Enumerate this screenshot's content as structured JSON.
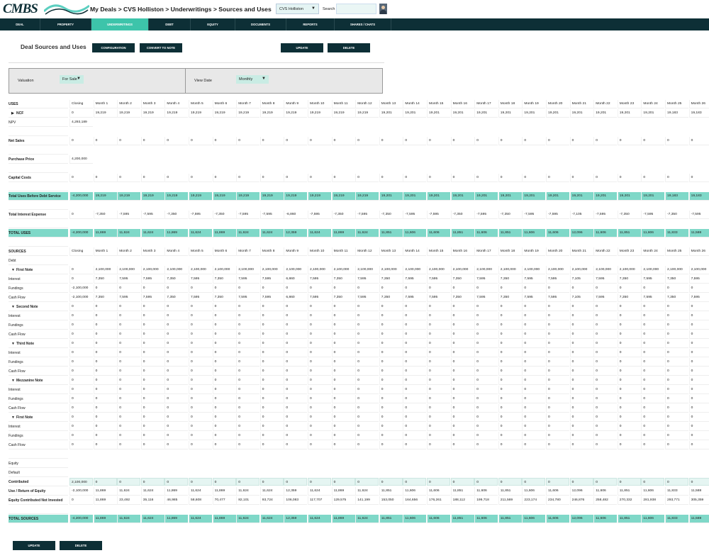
{
  "header": {
    "logo": "CMBS",
    "breadcrumb": "My Deals > CVS Holliston > Underwritings > Sources and Uses",
    "deal_select": "CVS Holliston",
    "search_label": "Search"
  },
  "nav": {
    "tabs": [
      "DEAL",
      "PROPERTY",
      "UNDERWRITINGS",
      "DEBT",
      "EQUITY",
      "DOCUMENTS",
      "REPORTS",
      "SHARES / CHATS"
    ],
    "active": "UNDERWRITINGS"
  },
  "page": {
    "title": "Deal Sources and Uses",
    "configuration": "CONFIGURATION",
    "convert": "CONVERT TO NOTE",
    "update": "UPDATE",
    "delete": "DELETE"
  },
  "filters": {
    "valuation_label": "Valuation",
    "valuation": "For Sale",
    "viewdate_label": "View Date",
    "viewdate": "Monthly"
  },
  "columns": [
    "Closing",
    "Month 1",
    "Month 2",
    "Month 3",
    "Month 4",
    "Month 5",
    "Month 6",
    "Month 7",
    "Month 8",
    "Month 9",
    "Month 10",
    "Month 11",
    "Month 12",
    "Month 13",
    "Month 14",
    "Month 15",
    "Month 16",
    "Month 17",
    "Month 18",
    "Month 19",
    "Month 20",
    "Month 21",
    "Month 22",
    "Month 23",
    "Month 24",
    "Month 25",
    "Month 26"
  ],
  "rows": [
    {
      "label": "USES",
      "bold": true,
      "header": true
    },
    {
      "label": "NCF",
      "bold": true,
      "chev": "▶",
      "values": [
        "0",
        "19,219",
        "19,219",
        "19,219",
        "19,219",
        "19,219",
        "19,219",
        "19,219",
        "19,219",
        "19,219",
        "19,219",
        "19,219",
        "19,219",
        "19,201",
        "19,201",
        "19,201",
        "19,201",
        "19,201",
        "19,201",
        "19,201",
        "19,201",
        "19,201",
        "19,201",
        "19,201",
        "19,201",
        "19,183",
        "19,183"
      ]
    },
    {
      "label": "NPV",
      "values": [
        "4,293,189"
      ]
    },
    {
      "label": ""
    },
    {
      "label": "Net Sales",
      "bold": true,
      "values": [
        "0",
        "0",
        "0",
        "0",
        "0",
        "0",
        "0",
        "0",
        "0",
        "0",
        "0",
        "0",
        "0",
        "0",
        "0",
        "0",
        "0",
        "0",
        "0",
        "0",
        "0",
        "0",
        "0",
        "0",
        "0",
        "0",
        "0"
      ]
    },
    {
      "label": ""
    },
    {
      "label": "Purchase Price",
      "bold": true,
      "values": [
        "4,200,000"
      ]
    },
    {
      "label": ""
    },
    {
      "label": "Capital Costs",
      "bold": true,
      "values": [
        "0",
        "0",
        "0",
        "0",
        "0",
        "0",
        "0",
        "0",
        "0",
        "0",
        "0",
        "0",
        "0",
        "0",
        "0",
        "0",
        "0",
        "0",
        "0",
        "0",
        "0",
        "0",
        "0",
        "0",
        "0",
        "0",
        "0"
      ]
    },
    {
      "label": ""
    },
    {
      "label": "Total Uses Before Debt Service",
      "bold": true,
      "green": true,
      "values": [
        "-4,200,000",
        "19,219",
        "19,219",
        "19,219",
        "19,219",
        "19,219",
        "19,219",
        "19,219",
        "19,219",
        "19,219",
        "19,219",
        "19,219",
        "19,219",
        "19,201",
        "19,201",
        "19,201",
        "19,201",
        "19,201",
        "19,201",
        "19,201",
        "19,201",
        "19,201",
        "19,201",
        "19,201",
        "19,201",
        "19,183",
        "19,183"
      ]
    },
    {
      "label": ""
    },
    {
      "label": "Total Interest Expense",
      "bold": true,
      "values": [
        "0",
        "-7,350",
        "-7,595",
        "-7,595",
        "-7,350",
        "-7,595",
        "-7,350",
        "-7,595",
        "-7,595",
        "-6,860",
        "-7,595",
        "-7,350",
        "-7,595",
        "-7,350",
        "-7,595",
        "-7,595",
        "-7,350",
        "-7,595",
        "-7,350",
        "-7,595",
        "-7,595",
        "-7,105",
        "-7,595",
        "-7,350",
        "-7,595",
        "-7,350",
        "-7,595"
      ]
    },
    {
      "label": ""
    },
    {
      "label": "TOTAL USES",
      "bold": true,
      "green": true,
      "values": [
        "-4,200,000",
        "11,869",
        "11,624",
        "11,624",
        "11,869",
        "11,624",
        "11,869",
        "11,624",
        "11,624",
        "12,359",
        "11,624",
        "11,869",
        "11,624",
        "11,851",
        "11,606",
        "11,606",
        "11,851",
        "11,606",
        "11,851",
        "11,606",
        "11,606",
        "12,096",
        "11,606",
        "11,851",
        "11,606",
        "11,833",
        "11,588"
      ]
    },
    {
      "label": ""
    },
    {
      "label": "SOURCES",
      "bold": true,
      "header": true,
      "colhead": true
    },
    {
      "label": "Debt"
    },
    {
      "label": "First Note",
      "bold": true,
      "chev": "▼",
      "values": [
        "0",
        "2,100,000",
        "2,100,000",
        "2,100,000",
        "2,100,000",
        "2,100,000",
        "2,100,000",
        "2,100,000",
        "2,100,000",
        "2,100,000",
        "2,100,000",
        "2,100,000",
        "2,100,000",
        "2,100,000",
        "2,100,000",
        "2,100,000",
        "2,100,000",
        "2,100,000",
        "2,100,000",
        "2,100,000",
        "2,100,000",
        "2,100,000",
        "2,100,000",
        "2,100,000",
        "2,100,000",
        "2,100,000",
        "2,100,000"
      ]
    },
    {
      "label": "Interest",
      "values": [
        "0",
        "7,350",
        "7,595",
        "7,595",
        "7,350",
        "7,595",
        "7,350",
        "7,595",
        "7,595",
        "6,860",
        "7,595",
        "7,350",
        "7,595",
        "7,350",
        "7,595",
        "7,595",
        "7,350",
        "7,595",
        "7,350",
        "7,595",
        "7,595",
        "7,105",
        "7,595",
        "7,350",
        "7,595",
        "7,350",
        "7,595"
      ]
    },
    {
      "label": "Fundings",
      "values": [
        "-2,100,000",
        "0",
        "0",
        "0",
        "0",
        "0",
        "0",
        "0",
        "0",
        "0",
        "0",
        "0",
        "0",
        "0",
        "0",
        "0",
        "0",
        "0",
        "0",
        "0",
        "0",
        "0",
        "0",
        "0",
        "0",
        "0",
        "0"
      ]
    },
    {
      "label": "Cash Flow",
      "values": [
        "-2,100,000",
        "7,350",
        "7,595",
        "7,595",
        "7,350",
        "7,595",
        "7,350",
        "7,595",
        "7,595",
        "6,860",
        "7,595",
        "7,350",
        "7,595",
        "7,350",
        "7,595",
        "7,595",
        "7,350",
        "7,595",
        "7,350",
        "7,595",
        "7,595",
        "7,105",
        "7,595",
        "7,350",
        "7,595",
        "7,350",
        "7,595"
      ]
    },
    {
      "label": "Second Note",
      "bold": true,
      "chev": "▼",
      "values": [
        "0",
        "0",
        "0",
        "0",
        "0",
        "0",
        "0",
        "0",
        "0",
        "0",
        "0",
        "0",
        "0",
        "0",
        "0",
        "0",
        "0",
        "0",
        "0",
        "0",
        "0",
        "0",
        "0",
        "0",
        "0",
        "0",
        "0"
      ]
    },
    {
      "label": "Interest",
      "values": [
        "0",
        "0",
        "0",
        "0",
        "0",
        "0",
        "0",
        "0",
        "0",
        "0",
        "0",
        "0",
        "0",
        "0",
        "0",
        "0",
        "0",
        "0",
        "0",
        "0",
        "0",
        "0",
        "0",
        "0",
        "0",
        "0",
        "0"
      ]
    },
    {
      "label": "Fundings",
      "values": [
        "0",
        "0",
        "0",
        "0",
        "0",
        "0",
        "0",
        "0",
        "0",
        "0",
        "0",
        "0",
        "0",
        "0",
        "0",
        "0",
        "0",
        "0",
        "0",
        "0",
        "0",
        "0",
        "0",
        "0",
        "0",
        "0",
        "0"
      ]
    },
    {
      "label": "Cash Flow",
      "values": [
        "0",
        "0",
        "0",
        "0",
        "0",
        "0",
        "0",
        "0",
        "0",
        "0",
        "0",
        "0",
        "0",
        "0",
        "0",
        "0",
        "0",
        "0",
        "0",
        "0",
        "0",
        "0",
        "0",
        "0",
        "0",
        "0",
        "0"
      ]
    },
    {
      "label": "Third Note",
      "bold": true,
      "chev": "▼",
      "values": [
        "0",
        "0",
        "0",
        "0",
        "0",
        "0",
        "0",
        "0",
        "0",
        "0",
        "0",
        "0",
        "0",
        "0",
        "0",
        "0",
        "0",
        "0",
        "0",
        "0",
        "0",
        "0",
        "0",
        "0",
        "0",
        "0",
        "0"
      ]
    },
    {
      "label": "Interest",
      "values": [
        "0",
        "0",
        "0",
        "0",
        "0",
        "0",
        "0",
        "0",
        "0",
        "0",
        "0",
        "0",
        "0",
        "0",
        "0",
        "0",
        "0",
        "0",
        "0",
        "0",
        "0",
        "0",
        "0",
        "0",
        "0",
        "0",
        "0"
      ]
    },
    {
      "label": "Fundings",
      "values": [
        "0",
        "0",
        "0",
        "0",
        "0",
        "0",
        "0",
        "0",
        "0",
        "0",
        "0",
        "0",
        "0",
        "0",
        "0",
        "0",
        "0",
        "0",
        "0",
        "0",
        "0",
        "0",
        "0",
        "0",
        "0",
        "0",
        "0"
      ]
    },
    {
      "label": "Cash Flow",
      "values": [
        "0",
        "0",
        "0",
        "0",
        "0",
        "0",
        "0",
        "0",
        "0",
        "0",
        "0",
        "0",
        "0",
        "0",
        "0",
        "0",
        "0",
        "0",
        "0",
        "0",
        "0",
        "0",
        "0",
        "0",
        "0",
        "0",
        "0"
      ]
    },
    {
      "label": "Mezzanine Note",
      "bold": true,
      "chev": "▼",
      "values": [
        "0",
        "0",
        "0",
        "0",
        "0",
        "0",
        "0",
        "0",
        "0",
        "0",
        "0",
        "0",
        "0",
        "0",
        "0",
        "0",
        "0",
        "0",
        "0",
        "0",
        "0",
        "0",
        "0",
        "0",
        "0",
        "0",
        "0"
      ]
    },
    {
      "label": "Interest",
      "values": [
        "0",
        "0",
        "0",
        "0",
        "0",
        "0",
        "0",
        "0",
        "0",
        "0",
        "0",
        "0",
        "0",
        "0",
        "0",
        "0",
        "0",
        "0",
        "0",
        "0",
        "0",
        "0",
        "0",
        "0",
        "0",
        "0",
        "0"
      ]
    },
    {
      "label": "Fundings",
      "values": [
        "0",
        "0",
        "0",
        "0",
        "0",
        "0",
        "0",
        "0",
        "0",
        "0",
        "0",
        "0",
        "0",
        "0",
        "0",
        "0",
        "0",
        "0",
        "0",
        "0",
        "0",
        "0",
        "0",
        "0",
        "0",
        "0",
        "0"
      ]
    },
    {
      "label": "Cash Flow",
      "values": [
        "0",
        "0",
        "0",
        "0",
        "0",
        "0",
        "0",
        "0",
        "0",
        "0",
        "0",
        "0",
        "0",
        "0",
        "0",
        "0",
        "0",
        "0",
        "0",
        "0",
        "0",
        "0",
        "0",
        "0",
        "0",
        "0",
        "0"
      ]
    },
    {
      "label": "First Note",
      "bold": true,
      "chev": "▼",
      "values": [
        "0",
        "0",
        "0",
        "0",
        "0",
        "0",
        "0",
        "0",
        "0",
        "0",
        "0",
        "0",
        "0",
        "0",
        "0",
        "0",
        "0",
        "0",
        "0",
        "0",
        "0",
        "0",
        "0",
        "0",
        "0",
        "0",
        "0"
      ]
    },
    {
      "label": "Interest",
      "values": [
        "0",
        "0",
        "0",
        "0",
        "0",
        "0",
        "0",
        "0",
        "0",
        "0",
        "0",
        "0",
        "0",
        "0",
        "0",
        "0",
        "0",
        "0",
        "0",
        "0",
        "0",
        "0",
        "0",
        "0",
        "0",
        "0",
        "0"
      ]
    },
    {
      "label": "Fundings",
      "values": [
        "0",
        "0",
        "0",
        "0",
        "0",
        "0",
        "0",
        "0",
        "0",
        "0",
        "0",
        "0",
        "0",
        "0",
        "0",
        "0",
        "0",
        "0",
        "0",
        "0",
        "0",
        "0",
        "0",
        "0",
        "0",
        "0",
        "0"
      ]
    },
    {
      "label": "Cash Flow",
      "values": [
        "0",
        "0",
        "0",
        "0",
        "0",
        "0",
        "0",
        "0",
        "0",
        "0",
        "0",
        "0",
        "0",
        "0",
        "0",
        "0",
        "0",
        "0",
        "0",
        "0",
        "0",
        "0",
        "0",
        "0",
        "0",
        "0",
        "0"
      ]
    },
    {
      "label": ""
    },
    {
      "label": "Equity"
    },
    {
      "label": "Default"
    },
    {
      "label": "Contributed",
      "bold": true,
      "inputs": true,
      "values": [
        "2,100,000",
        "0",
        "0",
        "0",
        "0",
        "0",
        "0",
        "0",
        "0",
        "0",
        "0",
        "0",
        "0",
        "0",
        "0",
        "0",
        "0",
        "0",
        "0",
        "0",
        "0",
        "0",
        "0",
        "0",
        "0",
        "0",
        "0"
      ]
    },
    {
      "label": "Use / Return of Equity",
      "bold": true,
      "values": [
        "-2,100,000",
        "11,869",
        "11,624",
        "11,624",
        "11,869",
        "11,624",
        "11,869",
        "11,624",
        "11,624",
        "12,359",
        "11,624",
        "11,869",
        "11,624",
        "11,851",
        "11,606",
        "11,606",
        "11,851",
        "11,606",
        "11,851",
        "11,606",
        "11,606",
        "12,096",
        "11,606",
        "11,851",
        "11,606",
        "11,833",
        "11,588"
      ]
    },
    {
      "label": "Equity Contributed Not Invested",
      "bold": true,
      "values": [
        "0",
        "11,869",
        "23,492",
        "35,116",
        "46,985",
        "58,608",
        "70,477",
        "82,101",
        "93,724",
        "106,083",
        "117,707",
        "129,575",
        "141,199",
        "153,050",
        "164,656",
        "176,261",
        "188,112",
        "199,718",
        "211,569",
        "223,174",
        "234,780",
        "246,876",
        "258,482",
        "270,332",
        "281,938",
        "293,771",
        "305,359"
      ]
    },
    {
      "label": ""
    },
    {
      "label": "TOTAL SOURCES",
      "bold": true,
      "green": true,
      "values": [
        "-4,200,000",
        "11,869",
        "11,624",
        "11,624",
        "11,869",
        "11,624",
        "11,869",
        "11,624",
        "11,624",
        "12,359",
        "11,624",
        "11,869",
        "11,624",
        "11,851",
        "11,606",
        "11,606",
        "11,851",
        "11,606",
        "11,851",
        "11,606",
        "11,606",
        "12,096",
        "11,606",
        "11,851",
        "11,606",
        "11,833",
        "11,588"
      ]
    }
  ],
  "footer": {
    "update": "UPDATE",
    "delete": "DELETE"
  }
}
